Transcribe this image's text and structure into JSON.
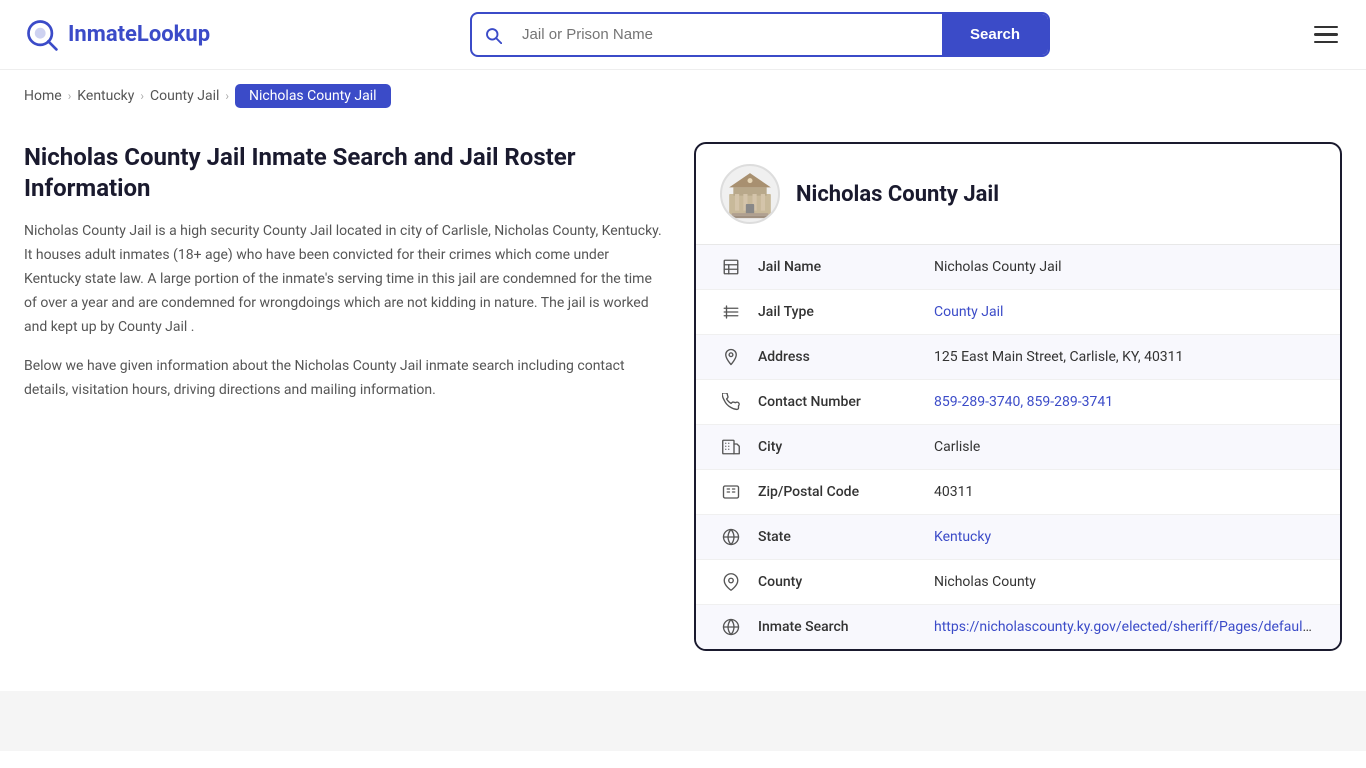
{
  "header": {
    "logo_text_normal": "Inmate",
    "logo_text_bold": "Lookup",
    "search_placeholder": "Jail or Prison Name",
    "search_button_label": "Search",
    "menu_label": "Menu"
  },
  "breadcrumb": {
    "items": [
      {
        "label": "Home",
        "href": "#",
        "active": false
      },
      {
        "label": "Kentucky",
        "href": "#",
        "active": false
      },
      {
        "label": "County Jail",
        "href": "#",
        "active": false
      },
      {
        "label": "Nicholas County Jail",
        "href": "#",
        "active": true
      }
    ]
  },
  "left": {
    "page_title": "Nicholas County Jail Inmate Search and Jail Roster Information",
    "description1": "Nicholas County Jail is a high security County Jail located in city of Carlisle, Nicholas County, Kentucky. It houses adult inmates (18+ age) who have been convicted for their crimes which come under Kentucky state law. A large portion of the inmate's serving time in this jail are condemned for the time of over a year and are condemned for wrongdoings which are not kidding in nature. The jail is worked and kept up by County Jail .",
    "description2": "Below we have given information about the Nicholas County Jail inmate search including contact details, visitation hours, driving directions and mailing information."
  },
  "card": {
    "title": "Nicholas County Jail",
    "rows": [
      {
        "icon": "jail-icon",
        "label": "Jail Name",
        "value": "Nicholas County Jail",
        "link": null
      },
      {
        "icon": "type-icon",
        "label": "Jail Type",
        "value": "County Jail",
        "link": "#"
      },
      {
        "icon": "address-icon",
        "label": "Address",
        "value": "125 East Main Street, Carlisle, KY, 40311",
        "link": null
      },
      {
        "icon": "phone-icon",
        "label": "Contact Number",
        "value": "859-289-3740, 859-289-3741",
        "link": "tel:8592893740"
      },
      {
        "icon": "city-icon",
        "label": "City",
        "value": "Carlisle",
        "link": null
      },
      {
        "icon": "zip-icon",
        "label": "Zip/Postal Code",
        "value": "40311",
        "link": null
      },
      {
        "icon": "state-icon",
        "label": "State",
        "value": "Kentucky",
        "link": "#"
      },
      {
        "icon": "county-icon",
        "label": "County",
        "value": "Nicholas County",
        "link": null
      },
      {
        "icon": "search-icon",
        "label": "Inmate Search",
        "value": "https://nicholascounty.ky.gov/elected/sheriff/Pages/default.aspx",
        "link": "https://nicholascounty.ky.gov/elected/sheriff/Pages/default.aspx"
      }
    ]
  }
}
